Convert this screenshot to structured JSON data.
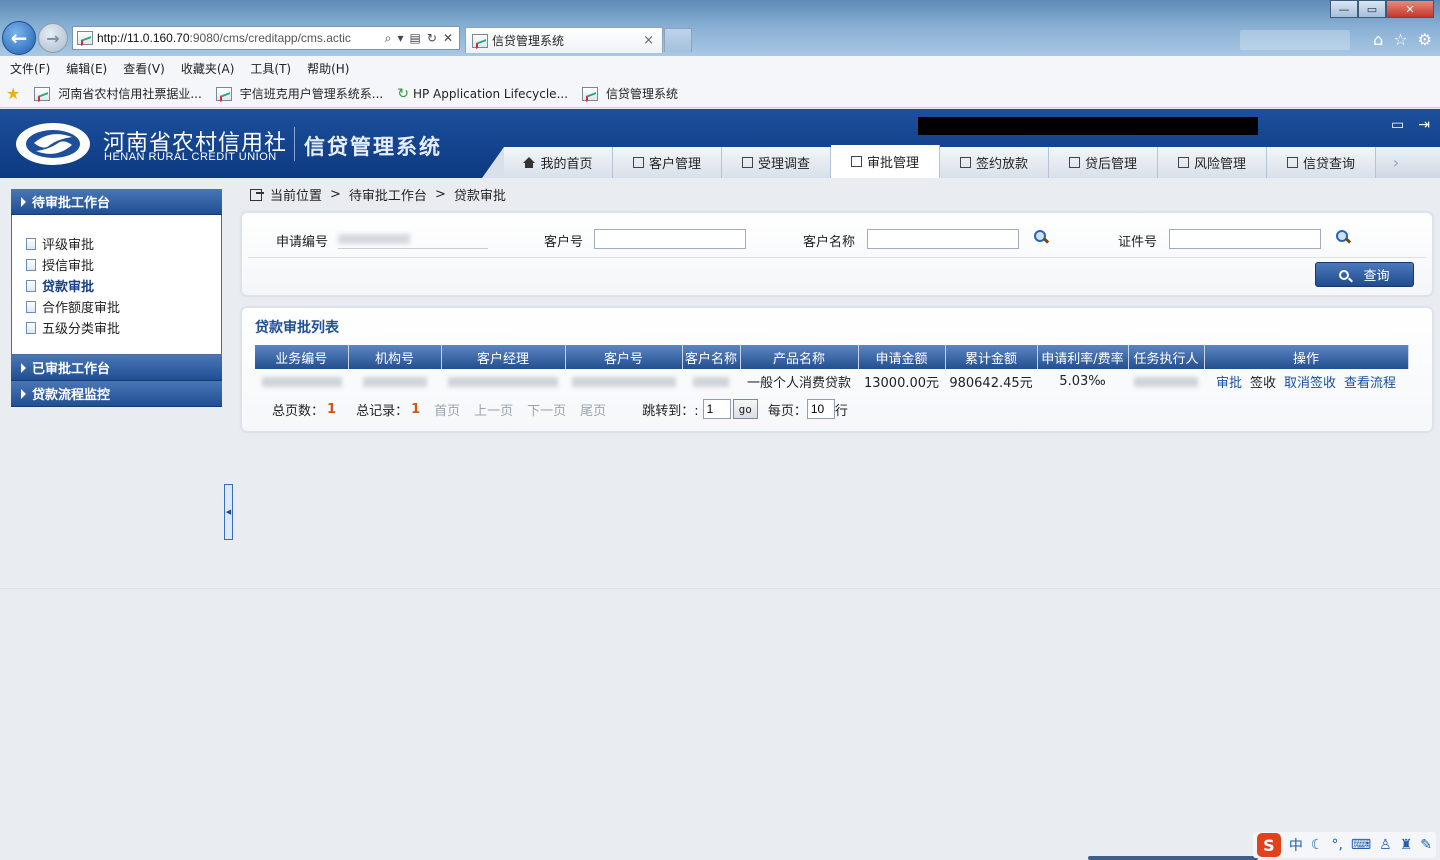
{
  "browser": {
    "url_host": "http://11.0.160.70",
    "url_rest": ":9080/cms/creditapp/cms.actic",
    "tab_title": "信贷管理系统",
    "tab_close": "×",
    "window_controls": {
      "minimize": "—",
      "maximize": "▭",
      "close": "✕"
    },
    "menu": [
      "文件(F)",
      "编辑(E)",
      "查看(V)",
      "收藏夹(A)",
      "工具(T)",
      "帮助(H)"
    ],
    "favorites": [
      "河南省农村信用社票据业...",
      "宇信班克用户管理系统系...",
      "HP Application Lifecycle...",
      "信贷管理系统"
    ]
  },
  "header": {
    "org_name": "河南省农村信用社",
    "org_name_en": "HENAN RURAL CREDIT UNION",
    "system_title": "信贷管理系统",
    "nav_tabs": [
      {
        "label": "我的首页",
        "icon": "home-icon"
      },
      {
        "label": "客户管理",
        "icon": "customer-icon"
      },
      {
        "label": "受理调查",
        "icon": "survey-icon"
      },
      {
        "label": "审批管理",
        "icon": "approval-icon",
        "active": true
      },
      {
        "label": "签约放款",
        "icon": "contract-icon"
      },
      {
        "label": "贷后管理",
        "icon": "postloan-icon"
      },
      {
        "label": "风险管理",
        "icon": "risk-icon"
      },
      {
        "label": "信贷查询",
        "icon": "query-icon"
      }
    ]
  },
  "sidebar": {
    "sections": [
      {
        "title": "待审批工作台",
        "expanded": true,
        "items": [
          "评级审批",
          "授信审批",
          "贷款审批",
          "合作额度审批",
          "五级分类审批"
        ],
        "active_item": "贷款审批"
      },
      {
        "title": "已审批工作台",
        "expanded": false
      },
      {
        "title": "贷款流程监控",
        "expanded": false
      }
    ]
  },
  "breadcrumb": {
    "label": "当前位置",
    "sep": ">",
    "path": [
      "待审批工作台",
      "贷款审批"
    ]
  },
  "search": {
    "app_no_label": "申请编号",
    "customer_no_label": "客户号",
    "customer_name_label": "客户名称",
    "cert_no_label": "证件号",
    "query_button": "查询"
  },
  "list": {
    "title": "贷款审批列表",
    "columns": [
      "业务编号",
      "机构号",
      "客户经理",
      "客户号",
      "客户名称",
      "产品名称",
      "申请金额",
      "累计金额",
      "申请利率/费率",
      "任务执行人",
      "操作"
    ],
    "rows": [
      {
        "product": "一般个人消费贷款",
        "amount": "13000.00元",
        "total": "980642.45元",
        "rate": "5.03‰",
        "ops": [
          "审批",
          "签收",
          "取消签收",
          "查看流程"
        ]
      }
    ]
  },
  "pager": {
    "total_pages_label": "总页数：",
    "total_pages": "1",
    "total_records_label": "总记录：",
    "total_records": "1",
    "first": "首页",
    "prev": "上一页",
    "next": "下一页",
    "last": "尾页",
    "jump_label": "跳转到：:",
    "jump_value": "1",
    "go": "go",
    "per_page_label": "每页：",
    "per_page": "10",
    "row_unit": "行"
  },
  "tray": {
    "ime_logo": "S",
    "ime_mode": "中",
    "icons": [
      "moon-icon",
      "punct-icon",
      "keyboard-icon",
      "user-icon",
      "shirt-icon",
      "wrench-icon"
    ]
  }
}
